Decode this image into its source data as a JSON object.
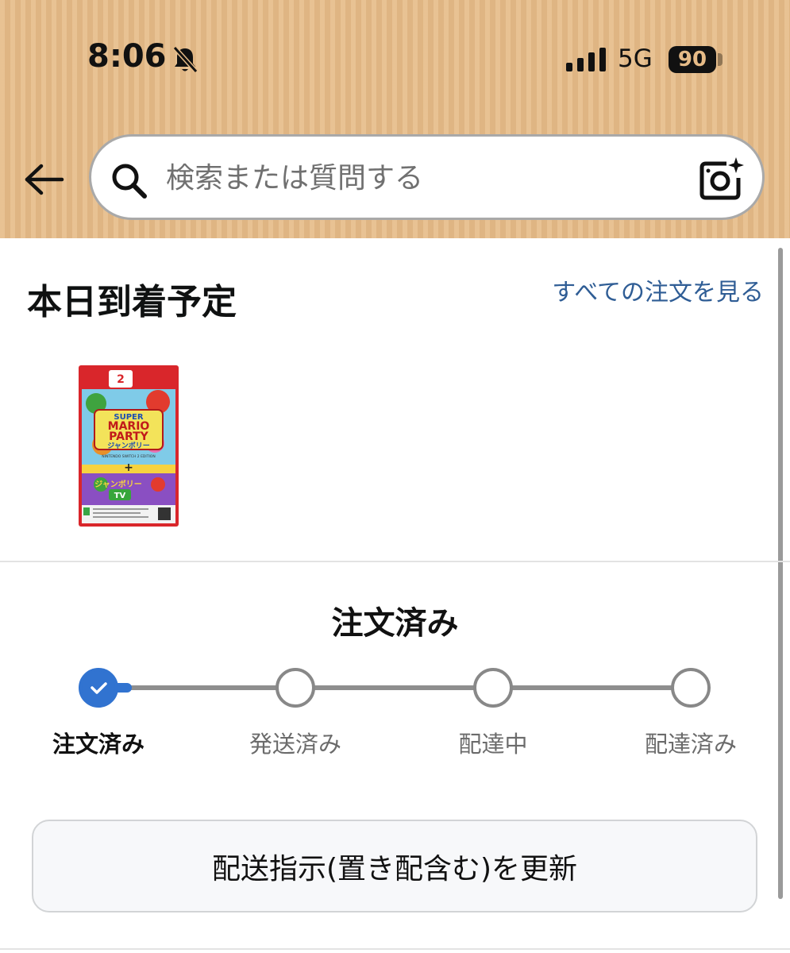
{
  "status_bar": {
    "time": "8:06",
    "network": "5G",
    "battery": "90"
  },
  "search": {
    "placeholder": "検索または質問する"
  },
  "arrival": {
    "title": "本日到着予定",
    "all_orders_link": "すべての注文を見る",
    "product": {
      "badge": "2",
      "title_line1": "SUPER",
      "title_line2": "MARIO",
      "title_line3": "PARTY",
      "title_jp": "ジャンボリー",
      "subtitle": "NINTENDO SWITCH 2 EDITION",
      "tv_title": "ジャンボリー",
      "tv_label": "TV"
    }
  },
  "tracking": {
    "current_status": "注文済み",
    "progress": 0,
    "steps": [
      {
        "label": "注文済み",
        "done": true
      },
      {
        "label": "発送済み",
        "done": false
      },
      {
        "label": "配達中",
        "done": false
      },
      {
        "label": "配達済み",
        "done": false
      }
    ]
  },
  "actions": {
    "update_delivery_label": "配送指示(置き配含む)を更新"
  },
  "colors": {
    "header_bg": "#e6bb87",
    "link": "#2f5d95",
    "progress": "#3173d0"
  }
}
